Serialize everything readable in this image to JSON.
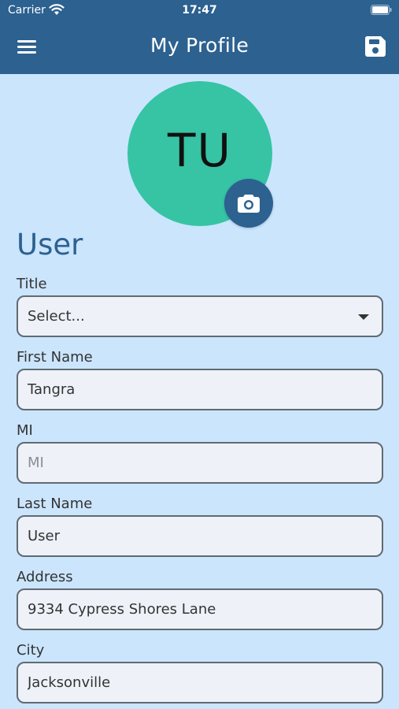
{
  "status_bar": {
    "carrier": "Carrier",
    "time": "17:47",
    "wifi_icon": "wifi-icon",
    "battery_icon": "battery-icon"
  },
  "navbar": {
    "title": "My Profile",
    "menu_icon": "hamburger-menu-icon",
    "save_icon": "floppy-disk-icon"
  },
  "avatar": {
    "initials": "TU",
    "color": "#36c4a5",
    "camera_icon": "camera-icon"
  },
  "section": {
    "title": "User"
  },
  "form": {
    "title": {
      "label": "Title",
      "value": "Select..."
    },
    "first_name": {
      "label": "First Name",
      "value": "Tangra"
    },
    "mi": {
      "label": "MI",
      "value": "",
      "placeholder": "MI"
    },
    "last_name": {
      "label": "Last Name",
      "value": "User"
    },
    "address": {
      "label": "Address",
      "value": "9334 Cypress Shores Lane"
    },
    "city": {
      "label": "City",
      "value": "Jacksonville"
    }
  },
  "colors": {
    "primary": "#2c6190",
    "background": "#cbe5fd",
    "field_bg": "#eef2f8",
    "avatar": "#36c4a5"
  }
}
